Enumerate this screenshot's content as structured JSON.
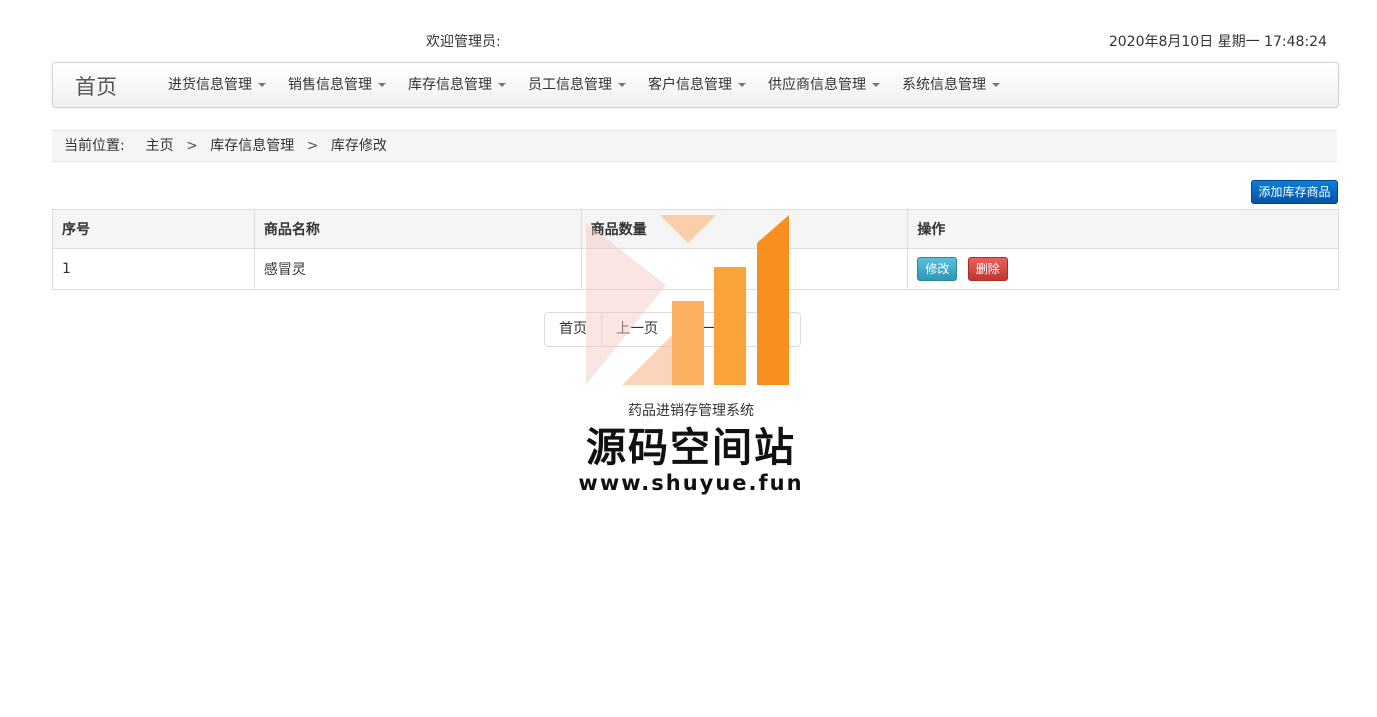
{
  "header": {
    "welcome_text": "欢迎管理员:",
    "datetime": "2020年8月10日 星期一 17:48:24"
  },
  "nav": {
    "brand": "首页",
    "items": [
      {
        "label": "进货信息管理"
      },
      {
        "label": "销售信息管理"
      },
      {
        "label": "库存信息管理"
      },
      {
        "label": "员工信息管理"
      },
      {
        "label": "客户信息管理"
      },
      {
        "label": "供应商信息管理"
      },
      {
        "label": "系统信息管理"
      }
    ]
  },
  "breadcrumb": {
    "prefix": "当前位置:",
    "items": [
      "主页",
      "库存信息管理",
      "库存修改"
    ],
    "separator": ">"
  },
  "toolbar": {
    "add_label": "添加库存商品"
  },
  "table": {
    "headers": [
      "序号",
      "商品名称",
      "商品数量",
      "操作"
    ],
    "rows": [
      {
        "index": "1",
        "name": "感冒灵",
        "quantity": ""
      }
    ],
    "edit_label": "修改",
    "delete_label": "删除"
  },
  "pagination": {
    "first": "首页",
    "prev": "上一页",
    "next": "下一页",
    "last": "尾页"
  },
  "watermark": {
    "subtitle": "药品进销存管理系统",
    "title": "源码空间站",
    "url": "www.shuyue.fun"
  },
  "colors": {
    "primary": "#0553a6",
    "info": "#5bc0de",
    "danger": "#ee5f5b",
    "watermark_orange": "#f7901e"
  }
}
